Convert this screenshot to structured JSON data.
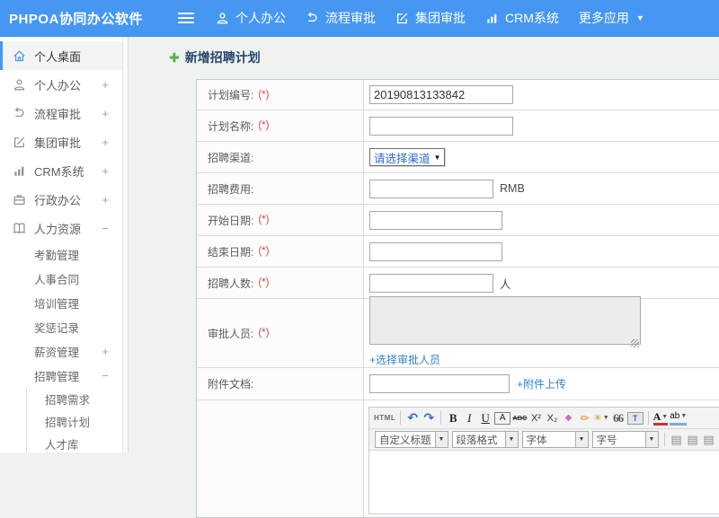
{
  "topbar": {
    "logo": "PHPOA协同办公软件",
    "nav": [
      {
        "key": "personal-office",
        "label": "个人办公",
        "icon": "user-icon"
      },
      {
        "key": "workflow-approval",
        "label": "流程审批",
        "icon": "process-icon"
      },
      {
        "key": "group-approval",
        "label": "集团审批",
        "icon": "edit-icon"
      },
      {
        "key": "crm-system",
        "label": "CRM系统",
        "icon": "chart-icon"
      },
      {
        "key": "more-apps",
        "label": "更多应用",
        "caret": "▼"
      }
    ]
  },
  "sidebar": {
    "items": [
      {
        "key": "personal-desktop",
        "label": "个人桌面",
        "icon": "home-icon",
        "active": true
      },
      {
        "key": "personal-office",
        "label": "个人办公",
        "icon": "user-icon",
        "expand": "+"
      },
      {
        "key": "workflow-approval",
        "label": "流程审批",
        "icon": "process-icon",
        "expand": "+"
      },
      {
        "key": "group-approval",
        "label": "集团审批",
        "icon": "edit-icon",
        "expand": "+"
      },
      {
        "key": "crm-system",
        "label": "CRM系统",
        "icon": "chart-icon",
        "expand": "+"
      },
      {
        "key": "admin-office",
        "label": "行政办公",
        "icon": "briefcase-icon",
        "expand": "+"
      },
      {
        "key": "human-resources",
        "label": "人力资源",
        "icon": "book-icon",
        "expand": "−",
        "children": [
          {
            "key": "attendance",
            "label": "考勤管理"
          },
          {
            "key": "hr-contract",
            "label": "人事合同"
          },
          {
            "key": "training",
            "label": "培训管理"
          },
          {
            "key": "rewards",
            "label": "奖惩记录"
          },
          {
            "key": "salary",
            "label": "薪资管理",
            "expand": "+"
          },
          {
            "key": "recruitment",
            "label": "招聘管理",
            "expand": "−",
            "children": [
              {
                "key": "recruit-demand",
                "label": "招聘需求"
              },
              {
                "key": "recruit-plan",
                "label": "招聘计划"
              },
              {
                "key": "talent-pool",
                "label": "人才库"
              }
            ]
          }
        ]
      }
    ]
  },
  "main": {
    "title": "新增招聘计划",
    "required_mark": "(*)",
    "form": {
      "plan_no": {
        "label": "计划编号:",
        "value": "20190813133842",
        "required": true
      },
      "plan_name": {
        "label": "计划名称:",
        "required": true
      },
      "channel": {
        "label": "招聘渠道:",
        "select_value": "请选择渠道",
        "caret": "▼"
      },
      "fee": {
        "label": "招聘费用:",
        "suffix": "RMB"
      },
      "start_date": {
        "label": "开始日期:",
        "required": true
      },
      "end_date": {
        "label": "结束日期:",
        "required": true
      },
      "headcount": {
        "label": "招聘人数:",
        "required": true,
        "suffix": "人"
      },
      "approver": {
        "label": "审批人员:",
        "required": true,
        "link": "+选择审批人员"
      },
      "attachment": {
        "label": "附件文档:",
        "link": "+附件上传"
      }
    },
    "editor": {
      "toolbar_row1": [
        {
          "name": "html-source-button",
          "label": "HTML",
          "style": "html"
        },
        {
          "name": "separator"
        },
        {
          "name": "undo-button",
          "label": "↶",
          "style": "blue"
        },
        {
          "name": "redo-button",
          "label": "↷",
          "style": "blue"
        },
        {
          "name": "separator"
        },
        {
          "name": "bold-button",
          "label": "B",
          "style": "bold"
        },
        {
          "name": "italic-button",
          "label": "I",
          "style": "italic"
        },
        {
          "name": "underline-button",
          "label": "U",
          "style": "underline"
        },
        {
          "name": "font-appearance-button",
          "label": "A",
          "style": "boxed"
        },
        {
          "name": "strikethrough-button",
          "label": "ABC",
          "style": "strike"
        },
        {
          "name": "superscript-button",
          "label": "X²",
          "style": "plain"
        },
        {
          "name": "subscript-button",
          "label": "X₂",
          "style": "plain"
        },
        {
          "name": "eraser-button",
          "label": "◆",
          "style": "pink"
        },
        {
          "name": "format-painter-button",
          "label": "✏",
          "style": "orange"
        },
        {
          "name": "auto-typeset-button",
          "label": "✳",
          "style": "wand",
          "caret": "▼"
        },
        {
          "name": "blockquote-button",
          "label": "66",
          "style": "quote"
        },
        {
          "name": "paste-button",
          "label": "T",
          "style": "paste"
        },
        {
          "name": "separator"
        },
        {
          "name": "font-color-button",
          "label": "A",
          "style": "fore",
          "caret": "▼"
        },
        {
          "name": "highlight-color-button",
          "label": "ab",
          "style": "hilite",
          "caret": "▼"
        }
      ],
      "toolbar_row2": [
        {
          "name": "heading-select",
          "label": "自定义标题",
          "type": "select",
          "caret": "▼"
        },
        {
          "name": "paragraph-format-select",
          "label": "段落格式",
          "type": "select",
          "caret": "▼"
        },
        {
          "name": "font-family-select",
          "label": "字体",
          "type": "select",
          "caret": "▼"
        },
        {
          "name": "font-size-select",
          "label": "字号",
          "type": "select",
          "caret": "▼"
        },
        {
          "name": "separator"
        },
        {
          "name": "align-left-button",
          "label": "▤",
          "style": "align"
        },
        {
          "name": "align-center-button",
          "label": "▤",
          "style": "align"
        },
        {
          "name": "align-right-button",
          "label": "▤",
          "style": "align"
        },
        {
          "name": "align-justify-button",
          "label": "▤",
          "style": "align"
        },
        {
          "name": "insert-link-button",
          "label": "∞",
          "style": "plain"
        }
      ]
    }
  },
  "colors": {
    "topbar_blue": "#4697f2",
    "link_blue": "#3484c6",
    "required_red": "#e24444",
    "title_navy": "#26476b",
    "plus_green": "#4db34d"
  }
}
